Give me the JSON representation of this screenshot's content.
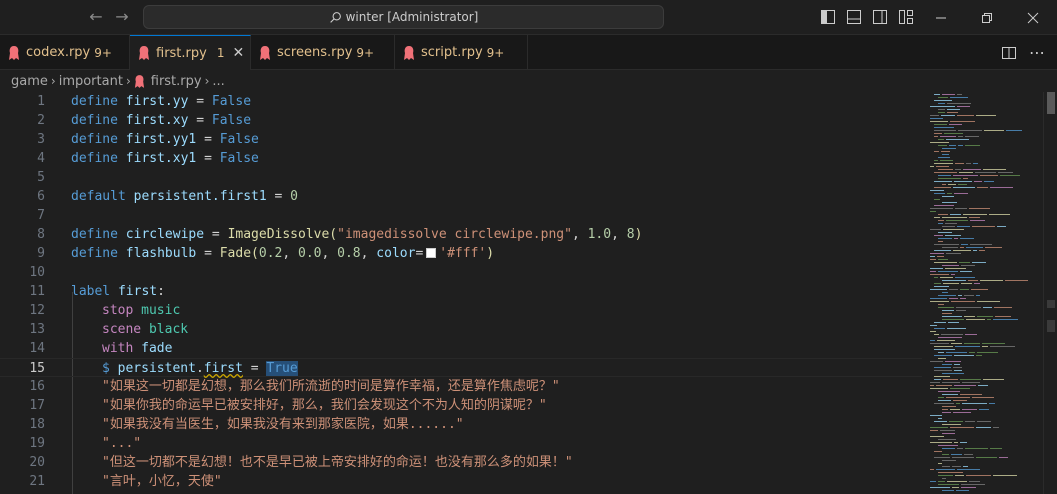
{
  "titlebar": {
    "search_text": "winter [Administrator]",
    "back_icon": "arrow-left-icon",
    "forward_icon": "arrow-right-icon"
  },
  "tabs": [
    {
      "name": "codex.rpy",
      "badge": "9+",
      "active": false
    },
    {
      "name": "first.rpy",
      "badge": "1",
      "active": true
    },
    {
      "name": "screens.rpy",
      "badge": "9+",
      "active": false
    },
    {
      "name": "script.rpy",
      "badge": "9+",
      "active": false
    }
  ],
  "breadcrumb": {
    "items": [
      "game",
      "important",
      "first.rpy",
      "..."
    ]
  },
  "editor": {
    "current_line": 15,
    "lines": [
      {
        "num": "1"
      },
      {
        "num": "2"
      },
      {
        "num": "3"
      },
      {
        "num": "4"
      },
      {
        "num": "5"
      },
      {
        "num": "6"
      },
      {
        "num": "7"
      },
      {
        "num": "8"
      },
      {
        "num": "9"
      },
      {
        "num": "10"
      },
      {
        "num": "11"
      },
      {
        "num": "12"
      },
      {
        "num": "13"
      },
      {
        "num": "14"
      },
      {
        "num": "15"
      },
      {
        "num": "16"
      },
      {
        "num": "17"
      },
      {
        "num": "18"
      },
      {
        "num": "19"
      },
      {
        "num": "20"
      },
      {
        "num": "21"
      }
    ],
    "code": {
      "l1": [
        "define",
        "first.yy",
        "=",
        "False"
      ],
      "l2": [
        "define",
        "first.xy",
        "=",
        "False"
      ],
      "l3": [
        "define",
        "first.yy1",
        "=",
        "False"
      ],
      "l4": [
        "define",
        "first.xy1",
        "=",
        "False"
      ],
      "l6": [
        "default",
        "persistent.first1",
        "=",
        "0"
      ],
      "l8": [
        "define",
        "circlewipe",
        "=",
        "ImageDissolve(",
        "\"imagedissolve circlewipe.png\"",
        ",",
        "1.0",
        ",",
        "8",
        ")"
      ],
      "l9": [
        "define",
        "flashbulb",
        "=",
        "Fade(",
        "0.2",
        ",",
        "0.0",
        ",",
        "0.8",
        ",",
        "color",
        "=",
        "'#fff'",
        ")"
      ],
      "l11": [
        "label",
        "first",
        ":"
      ],
      "l12": [
        "stop",
        "music"
      ],
      "l13": [
        "scene",
        "black"
      ],
      "l14": [
        "with",
        "fade"
      ],
      "l15": [
        "$",
        "persistent",
        ".",
        "first",
        "=",
        "True"
      ],
      "l16": "\"如果这一切都是幻想，那么我们所流逝的时间是算作幸福，还是算作焦虑呢？\"",
      "l17": "\"如果你我的命运早已被安排好，那么，我们会发现这个不为人知的阴谋呢？\"",
      "l18": "\"如果我没有当医生，如果我没有来到那家医院，如果......\"",
      "l19": "\"...\"",
      "l20": "\"但这一切都不是幻想！也不是早已被上帝安排好的命运！也没有那么多的如果！\"",
      "l21": "\"言叶，小忆，天使\""
    }
  },
  "colors": {
    "accent": "#0078d4",
    "modified": "#e2c08d"
  }
}
